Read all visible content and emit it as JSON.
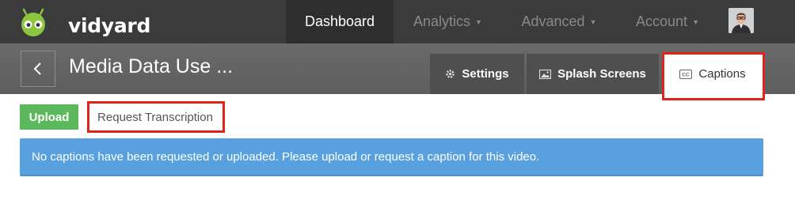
{
  "app": {
    "logo_text": "vidyard"
  },
  "nav": {
    "items": [
      {
        "label": "Dashboard",
        "active": true,
        "dropdown": false
      },
      {
        "label": "Analytics",
        "active": false,
        "dropdown": true
      },
      {
        "label": "Advanced",
        "active": false,
        "dropdown": true
      },
      {
        "label": "Account",
        "active": false,
        "dropdown": true
      }
    ],
    "avatar": "user-avatar"
  },
  "header": {
    "back_icon": "chevron-left-icon",
    "title": "Media Data Use ...",
    "tabs": [
      {
        "label": "Settings",
        "icon": "gear-icon",
        "active": false
      },
      {
        "label": "Splash Screens",
        "icon": "image-icon",
        "active": false
      },
      {
        "label": "Captions",
        "icon": "cc-icon",
        "active": true
      }
    ]
  },
  "content": {
    "upload_label": "Upload",
    "request_label": "Request Transcription",
    "alert_text": "No captions have been requested or uploaded. Please upload or request a caption for this video."
  },
  "colors": {
    "nav_bg": "#3b3b3b",
    "titlebar_bg": "#636363",
    "upload_green": "#5cb85c",
    "alert_blue": "#58a1de",
    "highlight_red": "#e2231a"
  }
}
